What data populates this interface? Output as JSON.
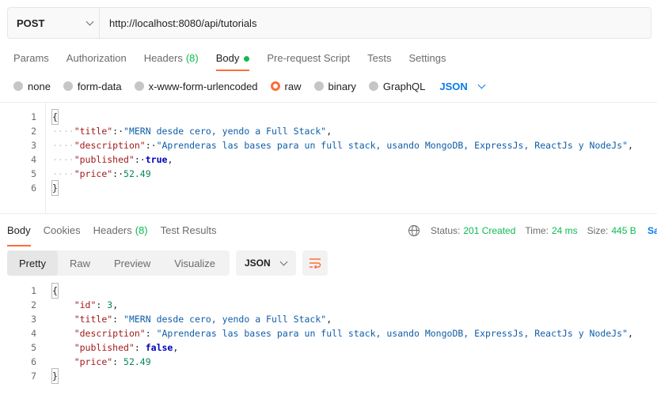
{
  "request": {
    "method": "POST",
    "url": "http://localhost:8080/api/tutorials"
  },
  "request_tabs": [
    {
      "label": "Params",
      "count": ""
    },
    {
      "label": "Authorization",
      "count": ""
    },
    {
      "label": "Headers",
      "count": "(8)"
    },
    {
      "label": "Body",
      "count": ""
    },
    {
      "label": "Pre-request Script",
      "count": ""
    },
    {
      "label": "Tests",
      "count": ""
    },
    {
      "label": "Settings",
      "count": ""
    }
  ],
  "body_types": [
    "none",
    "form-data",
    "x-www-form-urlencoded",
    "raw",
    "binary",
    "GraphQL"
  ],
  "body_selected": "raw",
  "body_format": "JSON",
  "request_body": {
    "line_numbers": [
      "1",
      "2",
      "3",
      "4",
      "5",
      "6"
    ],
    "title_key": "\"title\"",
    "title_value": "\"MERN desde cero, yendo a Full Stack\"",
    "description_key": "\"description\"",
    "description_value": "\"Aprenderas las bases para un full stack, usando MongoDB, ExpressJs, ReactJs y NodeJs\"",
    "published_key": "\"published\"",
    "published_value": "true",
    "price_key": "\"price\"",
    "price_value": "52.49"
  },
  "response_tabs": [
    {
      "label": "Body",
      "count": ""
    },
    {
      "label": "Cookies",
      "count": ""
    },
    {
      "label": "Headers",
      "count": "(8)"
    },
    {
      "label": "Test Results",
      "count": ""
    }
  ],
  "response_status": {
    "status_label": "Status:",
    "status_value": "201 Created",
    "time_label": "Time:",
    "time_value": "24 ms",
    "size_label": "Size:",
    "size_value": "445 B",
    "save_cut": "Sa"
  },
  "view_tabs": [
    "Pretty",
    "Raw",
    "Preview",
    "Visualize"
  ],
  "response_format": "JSON",
  "response_body": {
    "line_numbers": [
      "1",
      "2",
      "3",
      "4",
      "5",
      "6",
      "7"
    ],
    "id_key": "\"id\"",
    "id_value": "3",
    "title_key": "\"title\"",
    "title_value": "\"MERN desde cero, yendo a Full Stack\"",
    "description_key": "\"description\"",
    "description_value": "\"Aprenderas las bases para un full stack, usando MongoDB, ExpressJs, ReactJs y NodeJs\"",
    "published_key": "\"published\"",
    "published_value": "false",
    "price_key": "\"price\"",
    "price_value": "52.49"
  },
  "colors": {
    "accent": "#ff6c37",
    "success": "#0cbb52",
    "link": "#097bed"
  },
  "icons": [
    "chevron-down-icon",
    "globe-icon",
    "wrap-lines-icon"
  ]
}
